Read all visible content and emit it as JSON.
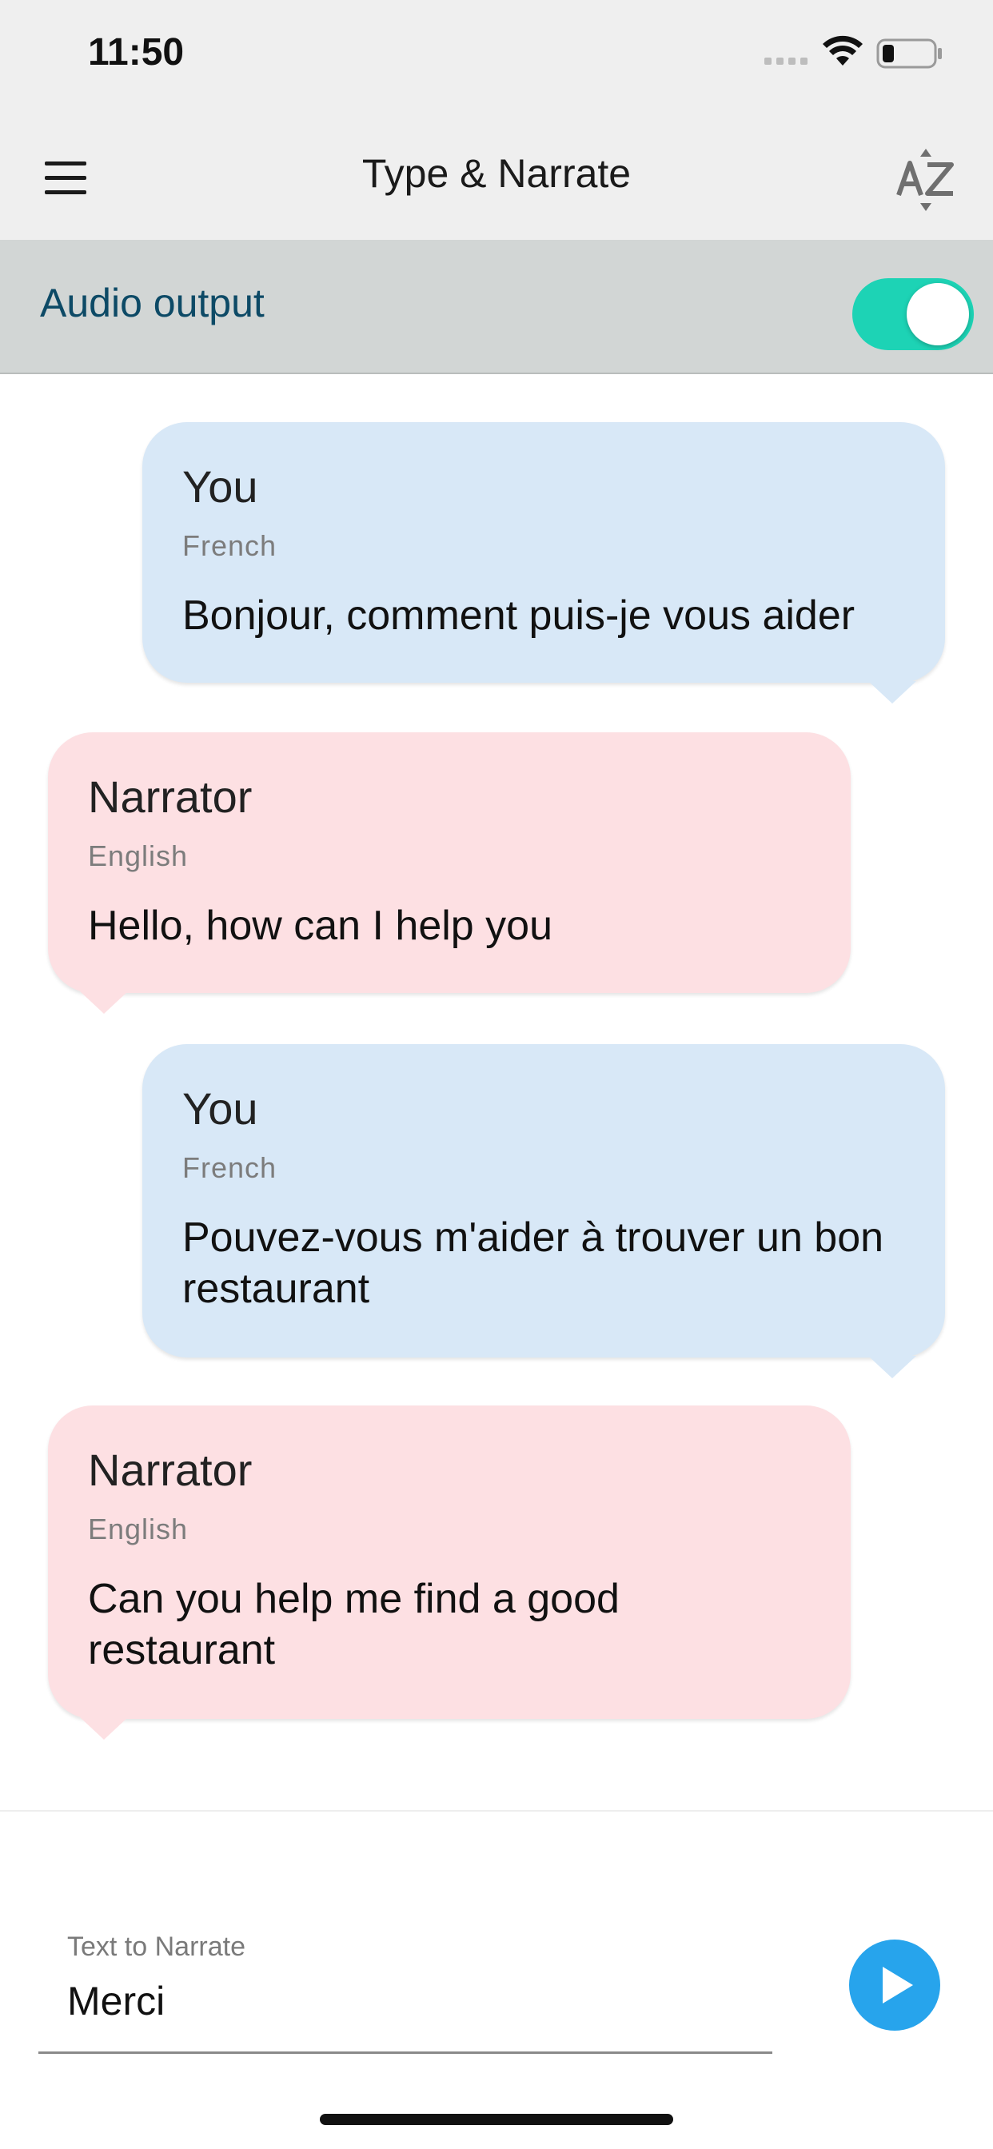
{
  "status_bar": {
    "time": "11:50"
  },
  "header": {
    "title": "Type & Narrate",
    "menu_icon": "hamburger-menu-icon",
    "sort_icon": "az-sort-icon"
  },
  "audio_output": {
    "label": "Audio output",
    "enabled": true,
    "accent": "#1dd3b5"
  },
  "messages": [
    {
      "speaker": "You",
      "language": "French",
      "text": "Bonjour, comment puis-je vous aider"
    },
    {
      "speaker": "Narrator",
      "language": "English",
      "text": "Hello, how can I help you"
    },
    {
      "speaker": "You",
      "language": "French",
      "text": "Pouvez-vous m'aider à trouver un bon restaurant"
    },
    {
      "speaker": "Narrator",
      "language": "English",
      "text": "Can you help me find a good restaurant"
    }
  ],
  "composer": {
    "label": "Text to Narrate",
    "value": "Merci",
    "play_icon": "play-icon"
  },
  "colors": {
    "you_bubble": "#d8e8f7",
    "narrator_bubble": "#fde0e3",
    "play_button": "#27a4ec",
    "audio_label": "#0d4a66"
  }
}
